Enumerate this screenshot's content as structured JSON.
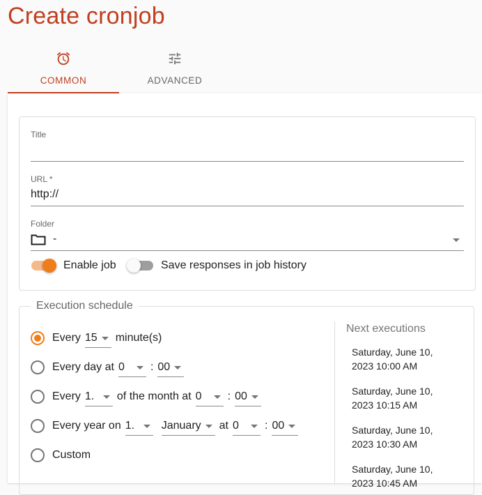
{
  "page": {
    "title": "Create cronjob"
  },
  "tabs": [
    {
      "label": "COMMON",
      "icon": "alarm-clock-icon",
      "active": true
    },
    {
      "label": "ADVANCED",
      "icon": "tune-sliders-icon",
      "active": false
    }
  ],
  "colors": {
    "accent": "#c0401f",
    "switch_on": "#ef7d1a",
    "switch_on_track": "#f5b98a"
  },
  "form": {
    "title": {
      "label": "Title",
      "value": ""
    },
    "url": {
      "label": "URL *",
      "value": "http://"
    },
    "folder": {
      "label": "Folder",
      "value": "-",
      "icon": "folder-icon"
    },
    "enable_job": {
      "label": "Enable job",
      "checked": true
    },
    "save_responses": {
      "label": "Save responses in job history",
      "checked": false
    }
  },
  "schedule": {
    "legend": "Execution schedule",
    "options": [
      {
        "checked": true,
        "parts": [
          "Every",
          "minute(s)"
        ],
        "selects": [
          "15"
        ]
      },
      {
        "checked": false,
        "parts": [
          "Every day at",
          ":"
        ],
        "selects": [
          "0",
          "00"
        ]
      },
      {
        "checked": false,
        "parts": [
          "Every",
          "of the month at",
          ":"
        ],
        "selects": [
          "1.",
          "0",
          "00"
        ]
      },
      {
        "checked": false,
        "parts": [
          "Every year on",
          "at",
          ":"
        ],
        "selects": [
          "1.",
          "January",
          "0",
          "00"
        ]
      },
      {
        "checked": false,
        "parts": [
          "Custom"
        ],
        "selects": []
      }
    ],
    "next_executions_title": "Next executions",
    "next_executions": [
      "Saturday, June 10, 2023 10:00 AM",
      "Saturday, June 10, 2023 10:15 AM",
      "Saturday, June 10, 2023 10:30 AM",
      "Saturday, June 10, 2023 10:45 AM"
    ]
  }
}
